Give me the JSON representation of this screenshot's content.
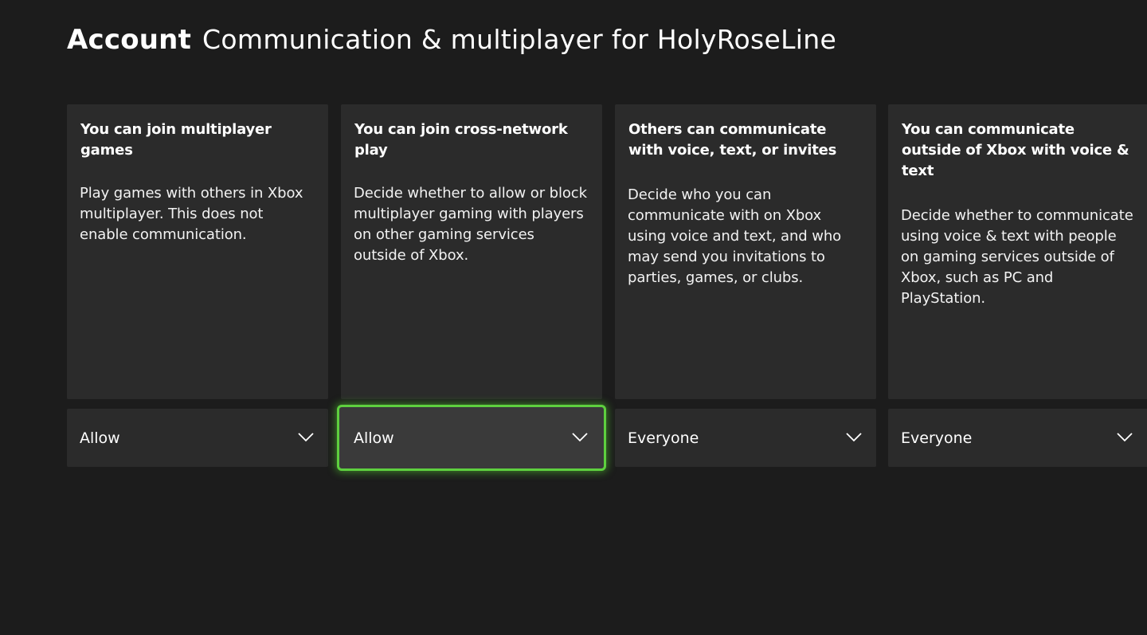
{
  "header": {
    "section": "Account",
    "title": "Communication & multiplayer for HolyRoseLine"
  },
  "settings": [
    {
      "title": "You can join multiplayer games",
      "description": "Play games with others in Xbox multiplayer. This does not enable communication.",
      "value": "Allow"
    },
    {
      "title": "You can join cross-network play",
      "description": "Decide whether to allow or block multiplayer gaming with players on other gaming services outside of Xbox.",
      "value": "Allow"
    },
    {
      "title": "Others can communicate with voice, text, or invites",
      "description": "Decide who you can communicate with on Xbox using voice and text, and who may send you invitations to parties, games, or clubs.",
      "value": "Everyone"
    },
    {
      "title": "You can communicate outside of Xbox with voice & text",
      "description": "Decide whether to communicate using voice & text with people on gaming services outside of Xbox, such as PC and PlayStation.",
      "value": "Everyone"
    }
  ],
  "focus": {
    "focused_control": "cross-network play dropdown",
    "focus_color": "#5ed03f"
  },
  "icons": {
    "dropdown": "chevron-down-icon"
  }
}
